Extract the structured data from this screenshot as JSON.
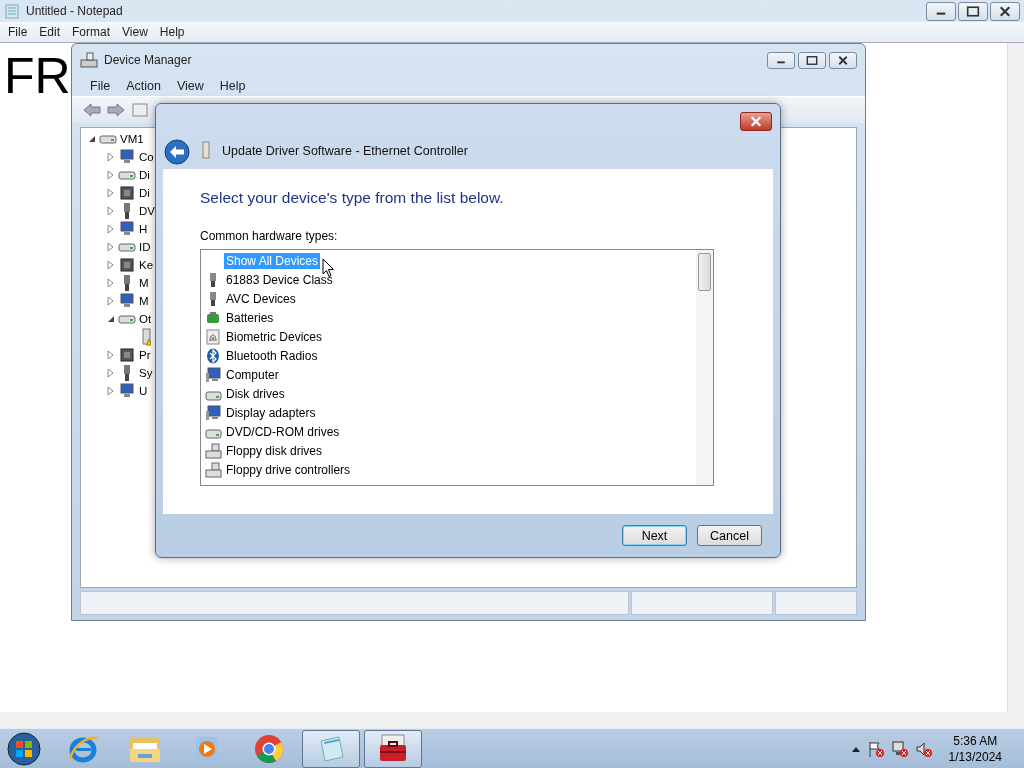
{
  "notepad": {
    "title": "Untitled - Notepad",
    "menu": [
      "File",
      "Edit",
      "Format",
      "View",
      "Help"
    ],
    "text": "FR"
  },
  "device_manager": {
    "title": "Device Manager",
    "menu": [
      "File",
      "Action",
      "View",
      "Help"
    ],
    "tree": {
      "label": "VM1",
      "expanded": true,
      "children": [
        {
          "label": "Co",
          "expanded": false
        },
        {
          "label": "Di",
          "expanded": false
        },
        {
          "label": "Di",
          "expanded": false
        },
        {
          "label": "DV",
          "expanded": false
        },
        {
          "label": "H",
          "expanded": false
        },
        {
          "label": "ID",
          "expanded": false
        },
        {
          "label": "Ke",
          "expanded": false
        },
        {
          "label": "M",
          "expanded": false
        },
        {
          "label": "M",
          "expanded": false
        },
        {
          "label": "Ot",
          "expanded": true,
          "children": [
            {
              "warning": true
            }
          ]
        },
        {
          "label": "Pr",
          "expanded": false
        },
        {
          "label": "Sy",
          "expanded": false
        },
        {
          "label": "U",
          "expanded": false
        }
      ]
    }
  },
  "dialog": {
    "title": "Update Driver Software - Ethernet Controller",
    "heading": "Select your device's type from the list below.",
    "list_label": "Common hardware types:",
    "items": [
      {
        "label": "Show All Devices",
        "selected": true
      },
      {
        "label": "61883 Device Class",
        "selected": false
      },
      {
        "label": "AVC Devices",
        "selected": false
      },
      {
        "label": "Batteries",
        "selected": false
      },
      {
        "label": "Biometric Devices",
        "selected": false
      },
      {
        "label": "Bluetooth Radios",
        "selected": false
      },
      {
        "label": "Computer",
        "selected": false
      },
      {
        "label": "Disk drives",
        "selected": false
      },
      {
        "label": "Display adapters",
        "selected": false
      },
      {
        "label": "DVD/CD-ROM drives",
        "selected": false
      },
      {
        "label": "Floppy disk drives",
        "selected": false
      },
      {
        "label": "Floppy drive controllers",
        "selected": false
      }
    ],
    "buttons": [
      {
        "label": "Next",
        "default": true
      },
      {
        "label": "Cancel",
        "default": false
      }
    ]
  },
  "taskbar": {
    "apps": [
      {
        "highlighted": false
      },
      {
        "highlighted": false
      },
      {
        "highlighted": false
      },
      {
        "highlighted": false
      },
      {
        "highlighted": true
      },
      {
        "highlighted": true
      }
    ]
  },
  "clock": {
    "time": "5:36 AM",
    "date": "1/13/2024"
  }
}
